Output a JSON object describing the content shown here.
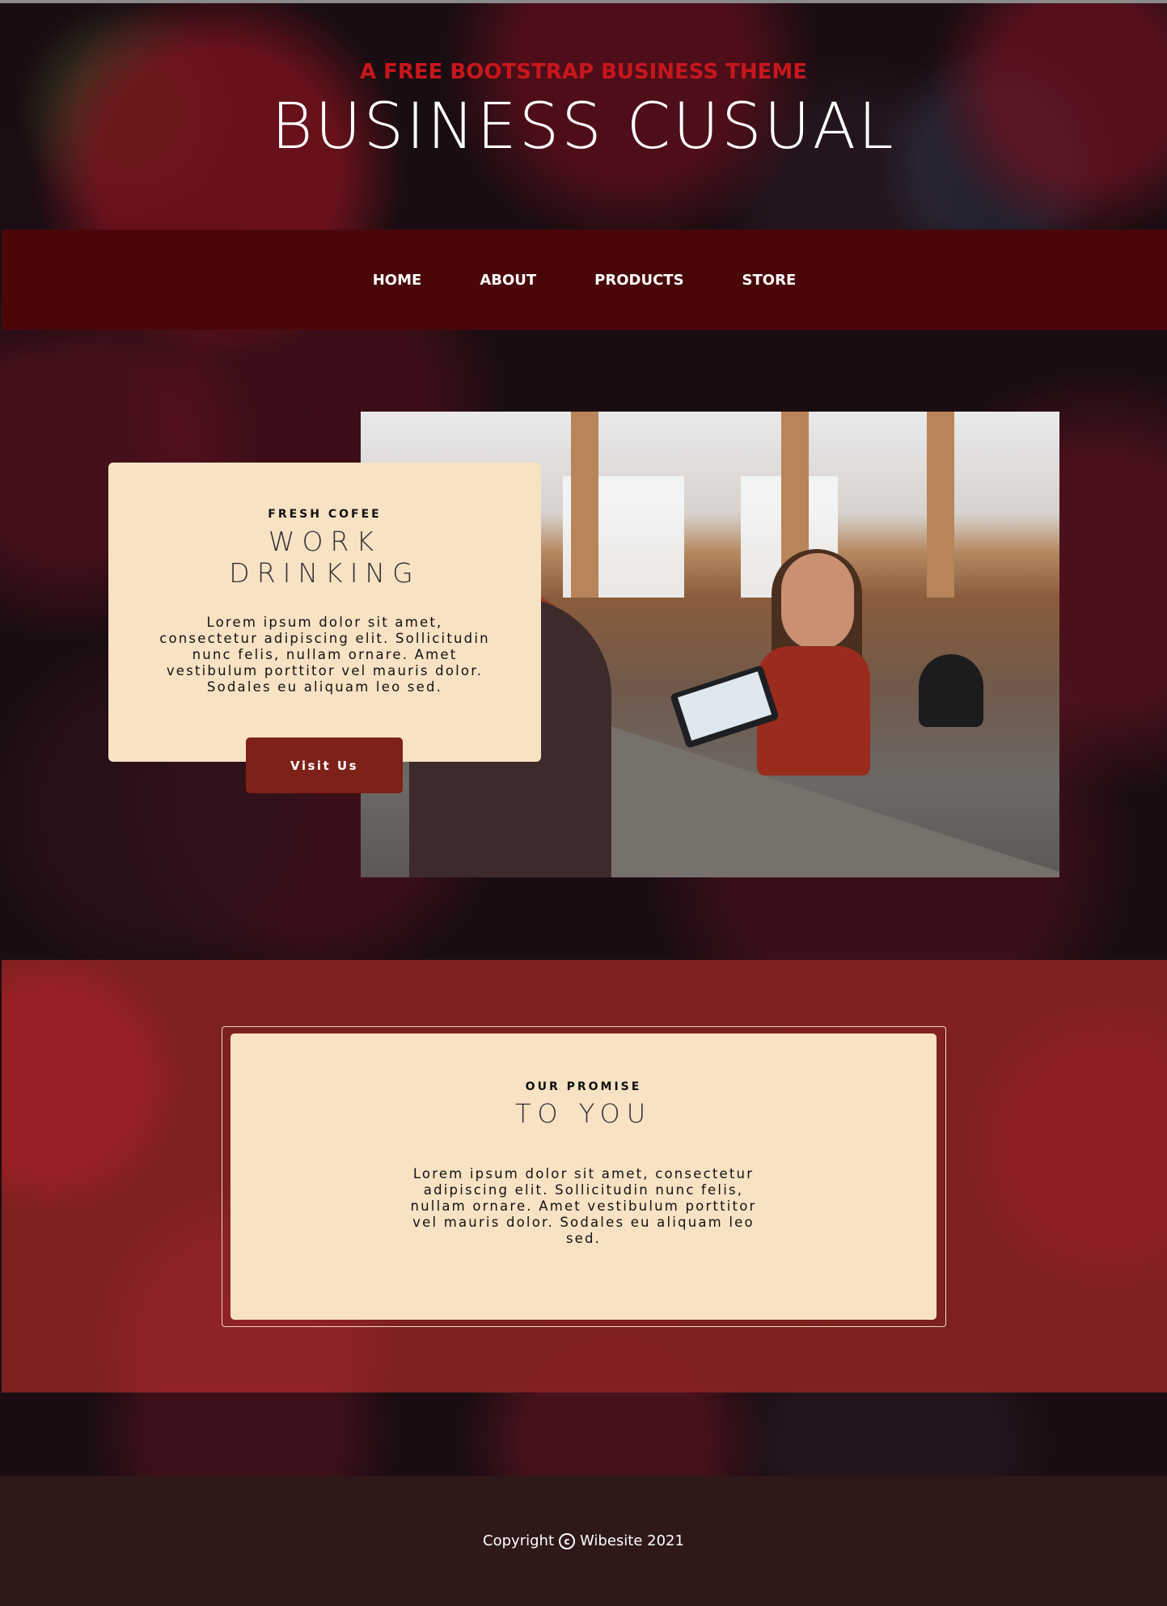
{
  "header": {
    "subtitle": "A FREE BOOTSTRAP BUSINESS THEME",
    "title": "BUSINESS CUSUAL"
  },
  "nav": {
    "items": [
      {
        "label": "HOME"
      },
      {
        "label": "ABOUT"
      },
      {
        "label": "PRODUCTS"
      },
      {
        "label": "STORE"
      }
    ]
  },
  "intro": {
    "kicker": "FRESH COFEE",
    "heading_line1": "WORK",
    "heading_line2": "DRINKING",
    "text": "Lorem ipsum dolor sit amet, consectetur adipiscing elit. Sollicitudin nunc felis, nullam ornare. Amet vestibulum porttitor vel mauris dolor. Sodales eu aliquam leo sed.",
    "button_label": "Visit Us",
    "image_icon": "store-photo"
  },
  "promise": {
    "kicker": "OUR PROMISE",
    "heading": "TO YOU",
    "text": "Lorem ipsum dolor sit amet, consectetur adipiscing elit. Sollicitudin nunc felis, nullam ornare. Amet vestibulum porttitor vel mauris dolor. Sodales eu aliquam leo sed."
  },
  "footer": {
    "copyright_label": "Copyright",
    "copyright_symbol": "c",
    "owner_year": "Wibesite 2021"
  },
  "colors": {
    "accent_red": "#c8161d",
    "nav_bg": "#4a0709",
    "card_bg": "#f7e2c4",
    "button_bg": "#7d2119",
    "footer_bg": "#2e1818"
  }
}
